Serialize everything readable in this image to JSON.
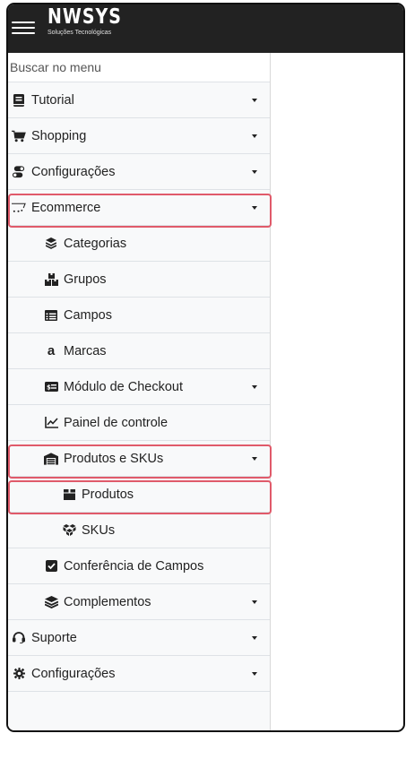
{
  "header": {
    "logo_main": "NWSYS",
    "logo_sub": "Soluções Tecnológicas"
  },
  "sidebar": {
    "search_placeholder": "Buscar no menu",
    "items": [
      {
        "label": "Tutorial",
        "icon": "book-icon",
        "level": 0,
        "caret": true
      },
      {
        "label": "Shopping",
        "icon": "cart-icon",
        "level": 0,
        "caret": true
      },
      {
        "label": "Configurações",
        "icon": "toggle-icon",
        "level": 0,
        "caret": true
      },
      {
        "label": "Ecommerce",
        "icon": "cart-outline-icon",
        "level": 0,
        "caret": true,
        "highlighted": true
      },
      {
        "label": "Categorias",
        "icon": "layers-icon",
        "level": 1,
        "caret": false
      },
      {
        "label": "Grupos",
        "icon": "boxes-icon",
        "level": 1,
        "caret": false
      },
      {
        "label": "Campos",
        "icon": "table-icon",
        "level": 1,
        "caret": false
      },
      {
        "label": "Marcas",
        "icon": "amazon-icon",
        "level": 1,
        "caret": false
      },
      {
        "label": "Módulo de Checkout",
        "icon": "money-check-icon",
        "level": 1,
        "caret": true
      },
      {
        "label": "Painel de controle",
        "icon": "line-chart-icon",
        "level": 1,
        "caret": false
      },
      {
        "label": "Produtos e SKUs",
        "icon": "warehouse-icon",
        "level": 1,
        "caret": true,
        "highlighted": true
      },
      {
        "label": "Produtos",
        "icon": "box-icon",
        "level": 2,
        "caret": false,
        "highlighted": true
      },
      {
        "label": "SKUs",
        "icon": "cubes-icon",
        "level": 2,
        "caret": false
      },
      {
        "label": "Conferência de Campos",
        "icon": "check-square-icon",
        "level": 1,
        "caret": false
      },
      {
        "label": "Complementos",
        "icon": "layer-group-icon",
        "level": 1,
        "caret": true
      },
      {
        "label": "Suporte",
        "icon": "headset-icon",
        "level": 0,
        "caret": true
      },
      {
        "label": "Configurações",
        "icon": "gear-icon",
        "level": 0,
        "caret": true
      }
    ]
  },
  "colors": {
    "topbar": "#222222",
    "sidebar_bg": "#f8f9fa",
    "highlight": "#e05a6a"
  }
}
